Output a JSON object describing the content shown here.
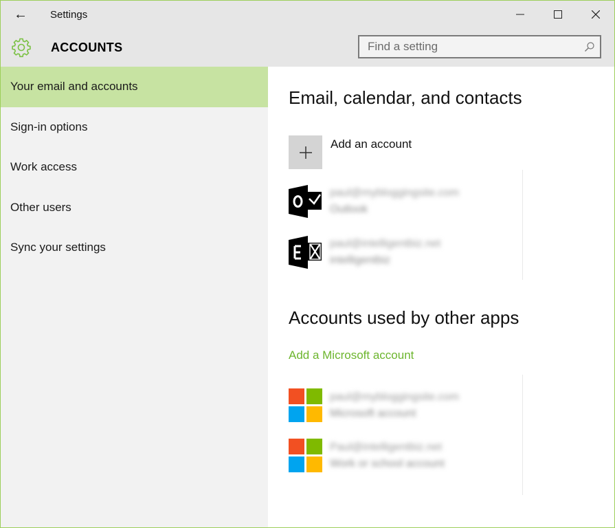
{
  "window": {
    "title": "Settings",
    "back_label": "←",
    "accent": "#9ccf5a"
  },
  "header": {
    "title": "ACCOUNTS",
    "search_placeholder": "Find a setting"
  },
  "sidebar": {
    "items": [
      {
        "label": "Your email and accounts",
        "active": true
      },
      {
        "label": "Sign-in options",
        "active": false
      },
      {
        "label": "Work access",
        "active": false
      },
      {
        "label": "Other users",
        "active": false
      },
      {
        "label": "Sync your settings",
        "active": false
      }
    ]
  },
  "content": {
    "section1_title": "Email, calendar, and contacts",
    "add_account_label": "Add an account",
    "email_accounts": [
      {
        "icon": "outlook-icon",
        "line1": "paul@mybloggingsite.com",
        "line2": "Outlook"
      },
      {
        "icon": "exchange-icon",
        "line1": "paul@intelligentbiz.net",
        "line2": "intelligentbiz"
      }
    ],
    "section2_title": "Accounts used by other apps",
    "add_ms_account_label": "Add a Microsoft account",
    "app_accounts": [
      {
        "icon": "microsoft-logo-icon",
        "line1": "paul@mybloggingsite.com",
        "line2": "Microsoft account"
      },
      {
        "icon": "microsoft-logo-icon",
        "line1": "Paul@intelligentbiz.net",
        "line2": "Work or school account"
      }
    ]
  },
  "colors": {
    "active_nav": "#c7e3a2",
    "link": "#6cb52d",
    "gear": "#7ac143",
    "ms_red": "#f25022",
    "ms_green": "#7fba00",
    "ms_blue": "#00a4ef",
    "ms_yellow": "#ffb900"
  }
}
